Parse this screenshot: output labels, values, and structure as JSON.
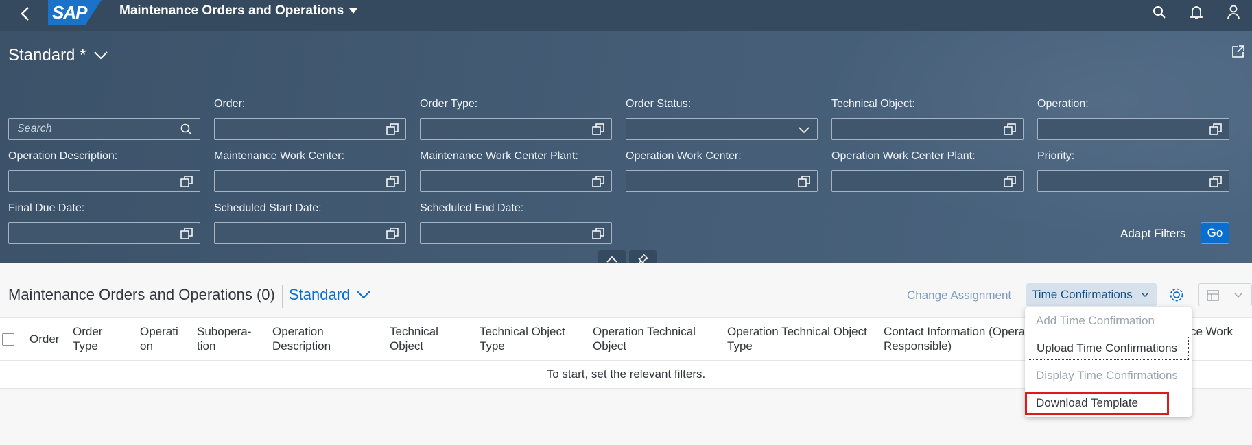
{
  "shell": {
    "logo": "SAP",
    "title": "Maintenance Orders and Operations"
  },
  "filterbar": {
    "variant": "Standard *",
    "search_placeholder": "Search",
    "filters": [
      {
        "label": "Order:"
      },
      {
        "label": "Order Type:"
      },
      {
        "label": "Order Status:"
      },
      {
        "label": "Technical Object:"
      },
      {
        "label": "Operation:"
      },
      {
        "label": "Operation Description:"
      },
      {
        "label": "Maintenance Work Center:"
      },
      {
        "label": "Maintenance Work Center Plant:"
      },
      {
        "label": "Operation Work Center:"
      },
      {
        "label": "Operation Work Center Plant:"
      },
      {
        "label": "Priority:"
      },
      {
        "label": "Final Due Date:"
      },
      {
        "label": "Scheduled Start Date:"
      },
      {
        "label": "Scheduled End Date:"
      }
    ],
    "adapt_filters": "Adapt Filters",
    "go": "Go"
  },
  "table": {
    "title": "Maintenance Orders and Operations (0)",
    "variant": "Standard",
    "change_assignment": "Change Assignment",
    "time_confirmations": "Time Confirmations",
    "columns": [
      {
        "line1": "Order",
        "line2": ""
      },
      {
        "line1": "Order",
        "line2": "Type"
      },
      {
        "line1": "Operati",
        "line2": "on"
      },
      {
        "line1": "Subopera-",
        "line2": "tion"
      },
      {
        "line1": "Operation",
        "line2": "Description"
      },
      {
        "line1": "Technical",
        "line2": "Object"
      },
      {
        "line1": "Technical Object",
        "line2": "Type"
      },
      {
        "line1": "Operation Technical",
        "line2": "Object"
      },
      {
        "line1": "Operation Technical Object",
        "line2": "Type"
      },
      {
        "line1": "Contact Information (Opera",
        "line2": "Responsible)"
      },
      {
        "line1": "ce Work",
        "line2": ""
      }
    ],
    "empty_text": "To start, set the relevant filters."
  },
  "menu": {
    "items": [
      {
        "label": "Add Time Confirmation",
        "state": "disabled"
      },
      {
        "label": "Upload Time Confirmations",
        "state": "focused"
      },
      {
        "label": "Display Time Confirmations",
        "state": "disabled"
      },
      {
        "label": "Download Template",
        "state": "highlighted"
      }
    ]
  },
  "colors": {
    "shell": "#354a5f",
    "accent": "#0a6ed1",
    "highlight": "#e01a1a"
  }
}
